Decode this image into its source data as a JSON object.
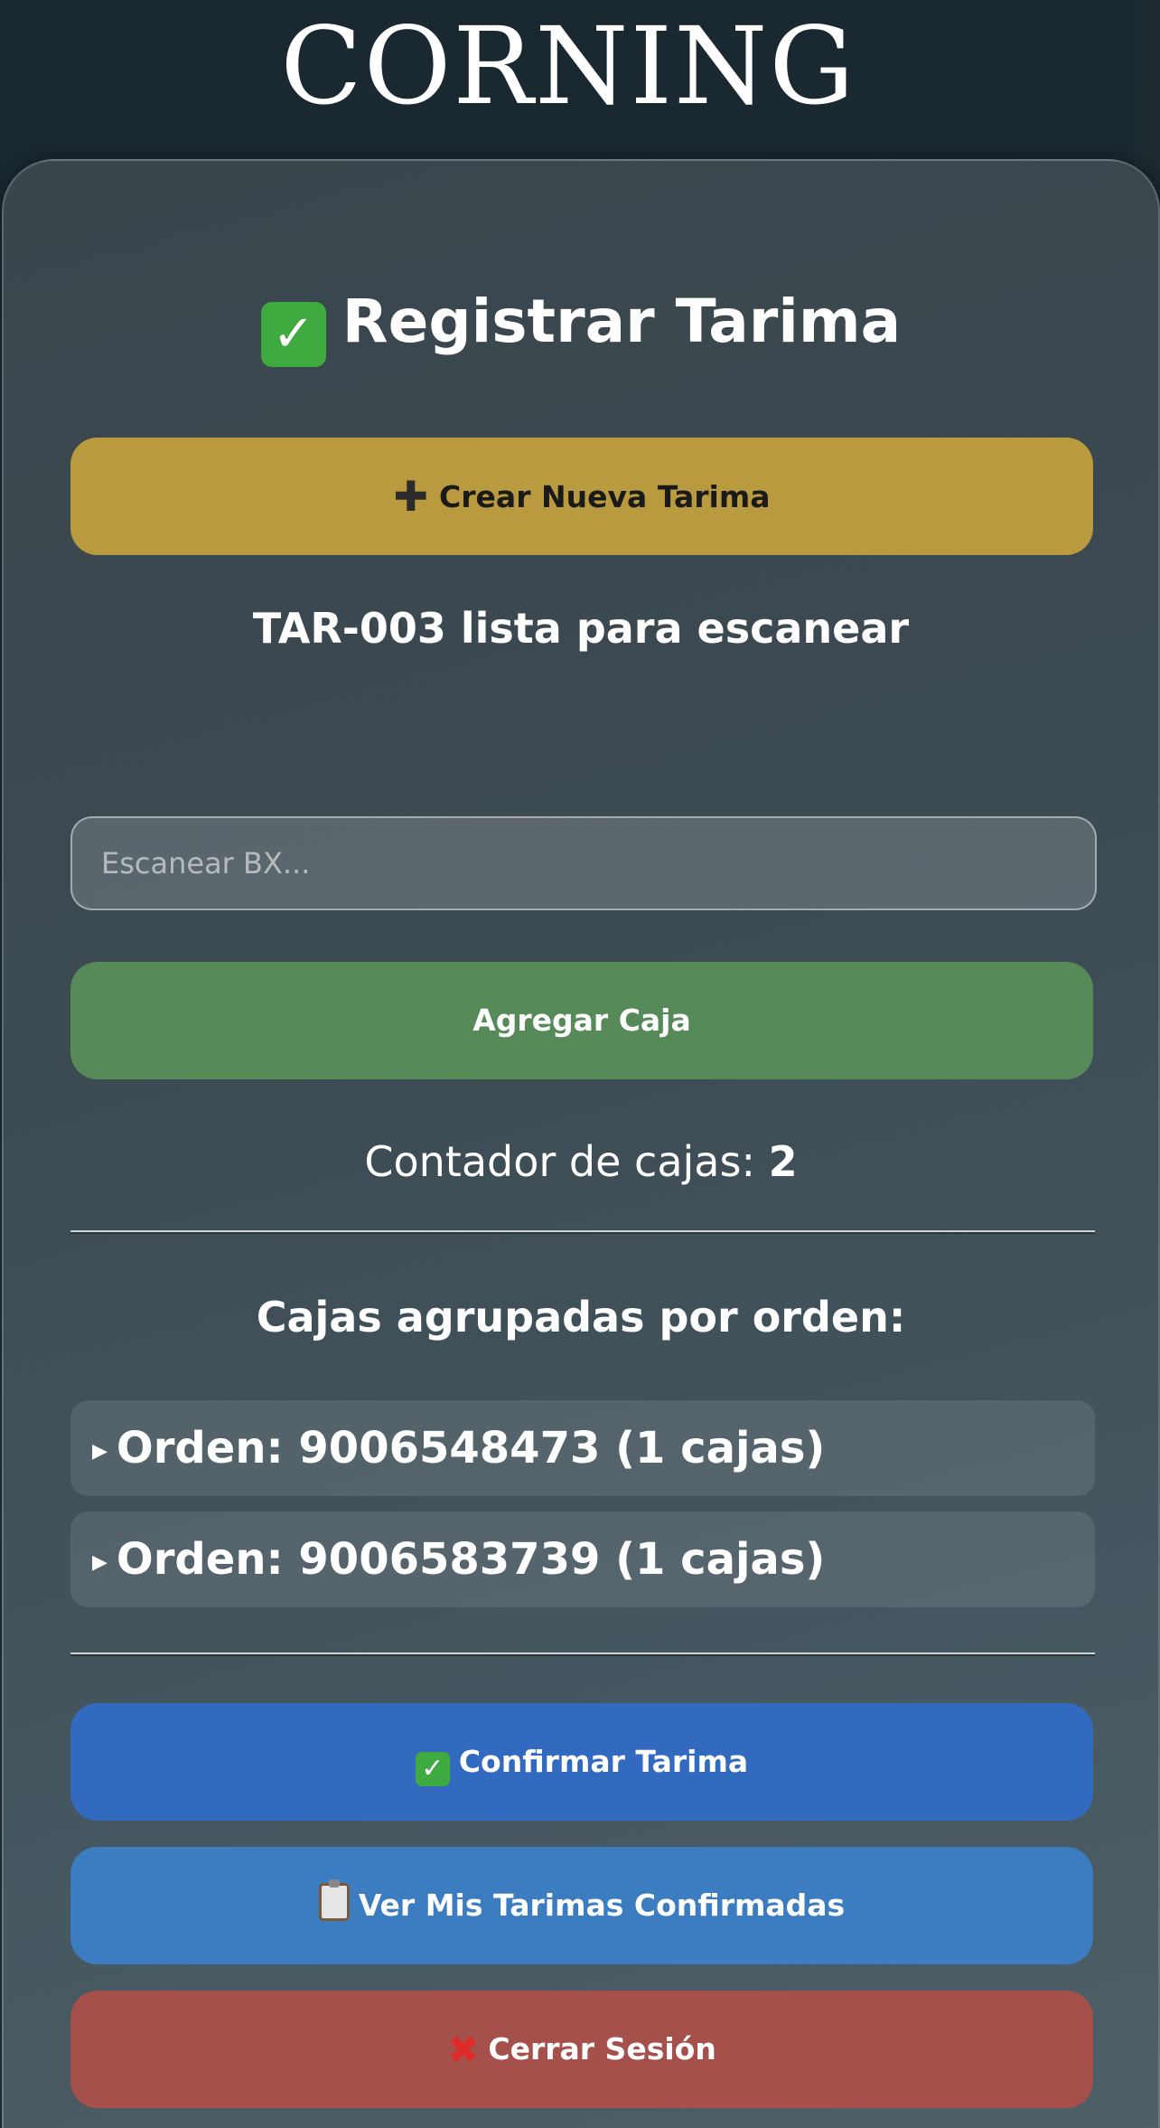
{
  "brand": {
    "logo_text": "CORNING"
  },
  "card": {
    "title": "Registrar Tarima",
    "title_icon": "check-mark-icon",
    "create_button": {
      "icon": "plus-icon",
      "label": "Crear Nueva Tarima",
      "color": "#b99a3f"
    },
    "status_text": "TAR-003 lista para escanear",
    "scan_input": {
      "placeholder": "Escanear BX...",
      "value": ""
    },
    "add_button": {
      "label": "Agregar Caja",
      "color": "#568a58"
    },
    "counter": {
      "label": "Contador de cajas: ",
      "value": "2"
    },
    "groups_title": "Cajas agrupadas por orden:",
    "orders": [
      {
        "label": "Orden: 9006548473 (1 cajas)",
        "expanded": false
      },
      {
        "label": "Orden: 9006583739 (1 cajas)",
        "expanded": false
      }
    ],
    "confirm_button": {
      "icon": "check-mark-icon",
      "label": "Confirmar Tarima",
      "color": "#326ac0"
    },
    "view_button": {
      "icon": "clipboard-icon",
      "label": "Ver Mis Tarimas Confirmadas",
      "color": "#3b7dc0"
    },
    "logout_button": {
      "icon": "cross-mark-icon",
      "label": "Cerrar Sesión",
      "color": "#a5504b"
    }
  }
}
